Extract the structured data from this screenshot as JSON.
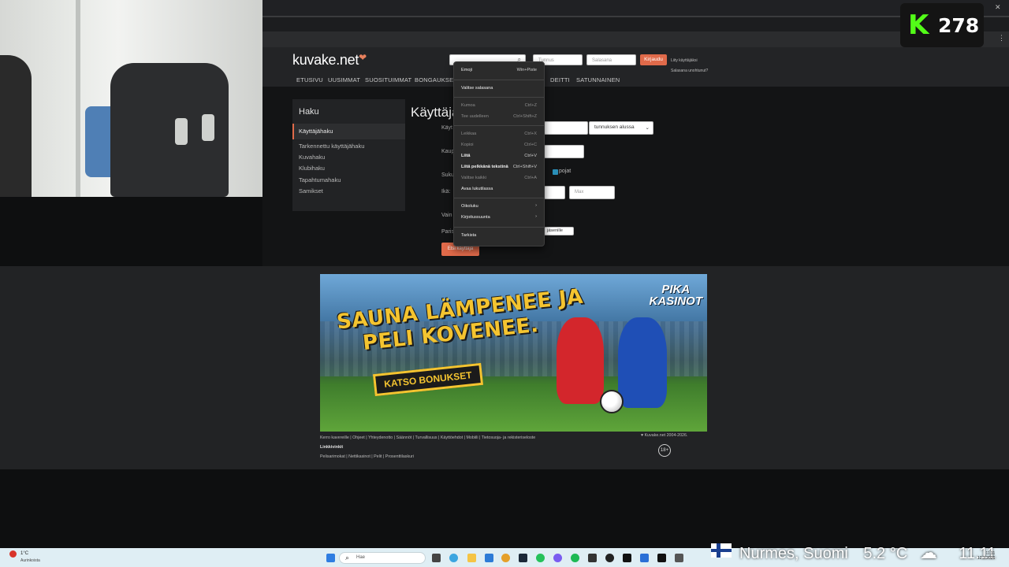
{
  "browser": {
    "window_controls": [
      "–",
      "□",
      "✕"
    ]
  },
  "site": {
    "logo": "kuvake.net",
    "nav": [
      "ETUSIVU",
      "UUSIMMAT",
      "SUOSITUIMMAT",
      "BONGAUKSET",
      "DEITTI",
      "SATUNNAINEN"
    ],
    "login": {
      "username_placeholder": "Tunnus",
      "password_placeholder": "Salasana",
      "button": "Kirjaudu",
      "join": "Liity käyttäjäksi",
      "forgot": "Salasana unohtunut?"
    }
  },
  "sidebar": {
    "title": "Haku",
    "active": "Käyttäjähaku",
    "items": [
      "Tarkennettu käyttäjähaku",
      "Kuvahaku",
      "Klubihaku",
      "Tapahtumahaku",
      "Samikset"
    ]
  },
  "main": {
    "title": "Käyttäjä",
    "labels": [
      "Käyt",
      "Kaup",
      "Suku",
      "Ikä:",
      "Vain",
      "Paris"
    ],
    "username_mode": "tunnuksen alussa",
    "boys_label": "pojat",
    "max_placeholder": "Max",
    "partner_select": "jäsenille",
    "search_button": "Etsi käyttäjä"
  },
  "context_menu": {
    "items": [
      {
        "label": "Emoji",
        "shortcut": "Win+Piste",
        "style": "normal"
      },
      {
        "label": "Valitse salasana",
        "shortcut": "",
        "style": "normal"
      },
      {
        "label": "Kumoa",
        "shortcut": "Ctrl+Z",
        "style": "dim"
      },
      {
        "label": "Tee uudelleen",
        "shortcut": "Ctrl+Shift+Z",
        "style": "dim"
      },
      {
        "label": "Leikkaa",
        "shortcut": "Ctrl+X",
        "style": "dim"
      },
      {
        "label": "Kopioi",
        "shortcut": "Ctrl+C",
        "style": "dim"
      },
      {
        "label": "Liitä",
        "shortcut": "Ctrl+V",
        "style": "bold"
      },
      {
        "label": "Liitä pelkkänä tekstinä",
        "shortcut": "Ctrl+Shift+V",
        "style": "bold"
      },
      {
        "label": "Valitse kaikki",
        "shortcut": "Ctrl+A",
        "style": "dim"
      },
      {
        "label": "Avaa lukutilassa",
        "shortcut": "",
        "style": "normal"
      },
      {
        "label": "Oikoluku",
        "shortcut": "›",
        "style": "normal"
      },
      {
        "label": "Kirjoitussuunta",
        "shortcut": "›",
        "style": "normal"
      },
      {
        "label": "Tarkista",
        "shortcut": "",
        "style": "normal"
      }
    ]
  },
  "banner": {
    "headline_1": "SAUNA LÄMPENEE JA",
    "headline_2": "PELI KOVENEE.",
    "button": "KATSO BONUKSET",
    "brand_1": "PIKA",
    "brand_2": "KASINOT"
  },
  "footer": {
    "links": [
      "Kerro kavereille",
      "Ohjeet",
      "Yhteydenotto",
      "Säännöt",
      "Turvallisuus",
      "Käyttöehdot",
      "Mobiili",
      "Tietosuoja- ja rekisteriseloste"
    ],
    "copyright": "Kuvake.net 2004-2026.",
    "partners_title": "Linkkivinkit",
    "partners": [
      "Pelisarimokat",
      "Nettikasinot",
      "Pelit",
      "Prosenttilaskuri"
    ],
    "age_badge": "18+"
  },
  "stream_overlay": {
    "counter_letter": "K",
    "counter_value": "278",
    "location": "Nurmes, Suomi",
    "temperature": "5.2 °C",
    "time": "11.11"
  },
  "taskbar": {
    "weather_temp": "1°C",
    "weather_desc": "Aurinkoista",
    "search_placeholder": "Hae",
    "tray_time": "11.11",
    "tray_date": "12.3.2026"
  }
}
